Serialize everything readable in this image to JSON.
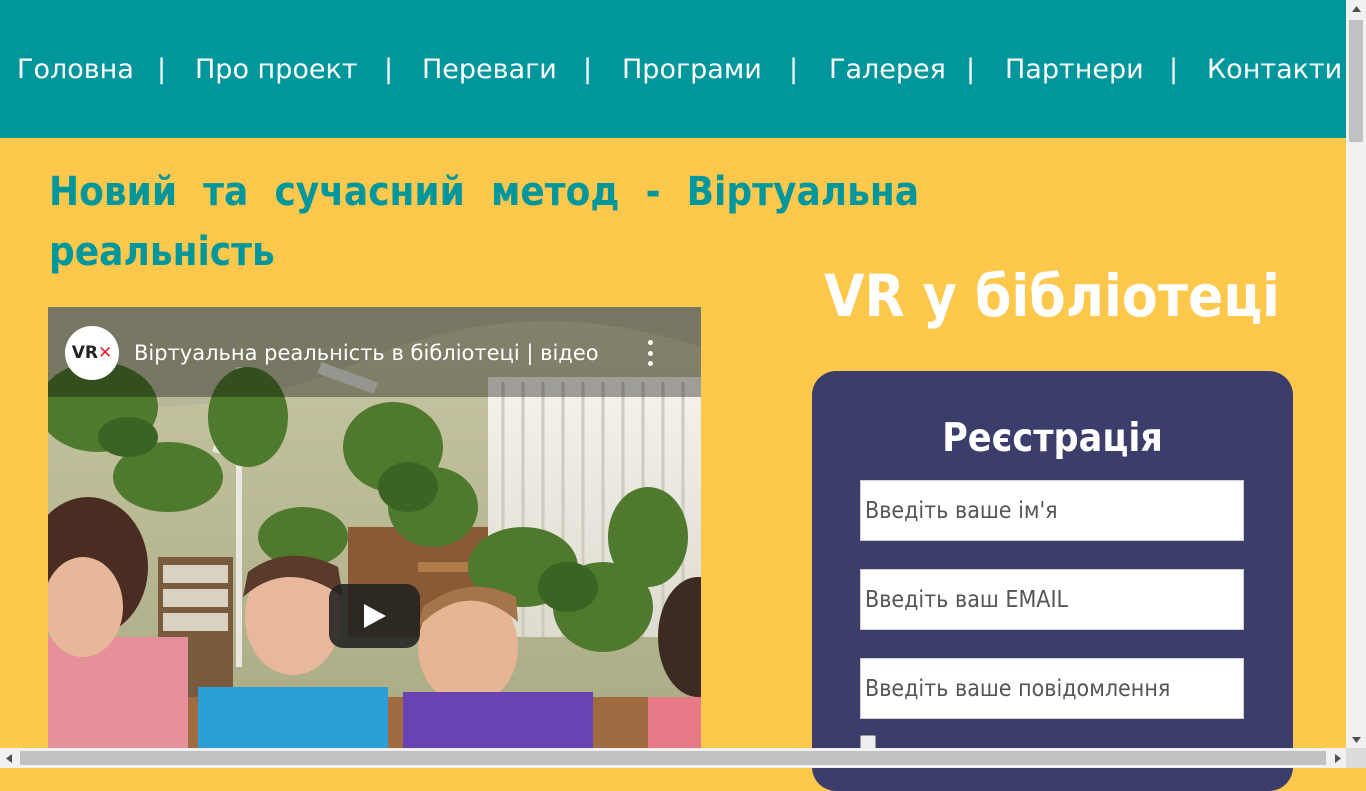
{
  "nav": {
    "items": [
      {
        "label": "Головна"
      },
      {
        "label": "Про проект"
      },
      {
        "label": "Переваги"
      },
      {
        "label": "Програми"
      },
      {
        "label": "Галерея"
      },
      {
        "label": "Партнери"
      },
      {
        "label": "Контакти"
      }
    ],
    "separator": "|"
  },
  "main": {
    "headline": "Новий та сучасний метод - Віртуальна реальність"
  },
  "video": {
    "channel_logo": {
      "text": "VR",
      "mark": "✕"
    },
    "title": "Віртуальна реальність в бібліотеці | відео",
    "play_icon": "play-icon",
    "menu_icon": "more-vert-icon"
  },
  "sidebar": {
    "heading": "VR у бібліотеці",
    "registration": {
      "title": "Реєстрація",
      "name_placeholder": "Введіть ваше ім'я",
      "email_placeholder": "Введіть ваш EMAIL",
      "message_placeholder": "Введіть ваше повідомлення"
    }
  },
  "colors": {
    "nav_bg": "#00979c",
    "page_bg": "#fec84d",
    "panel_bg": "#3b3d6b",
    "headline": "#00979c"
  }
}
